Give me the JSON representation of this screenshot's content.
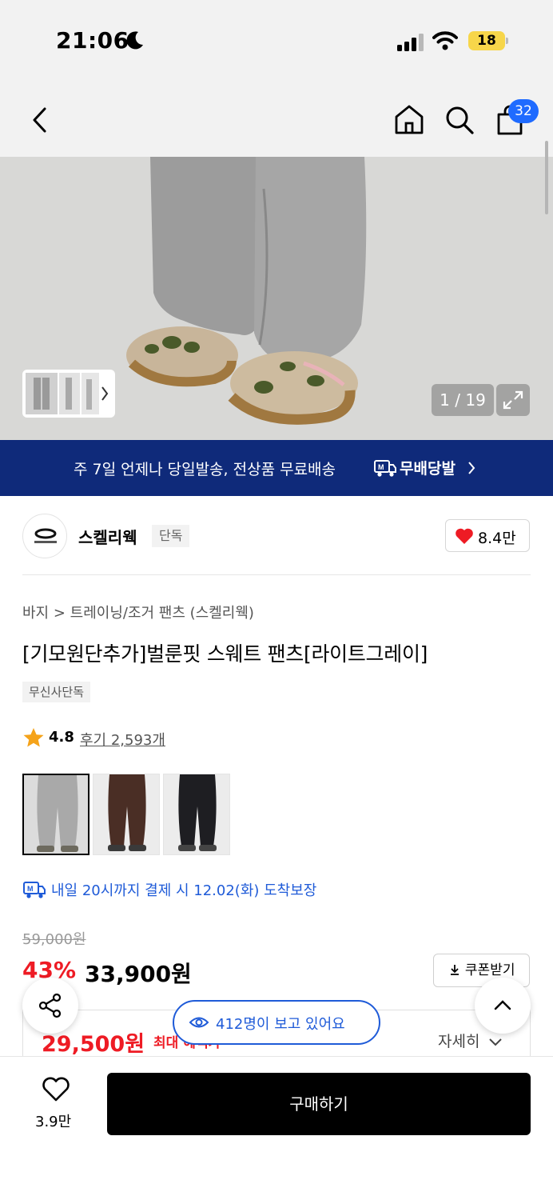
{
  "status_bar": {
    "time": "21:06",
    "battery": "18"
  },
  "nav": {
    "cart_count": "32"
  },
  "gallery": {
    "counter": "1 / 19"
  },
  "banner": {
    "text": "주 7일 언제나 당일발송, 전상품 무료배송",
    "brand": "무배당발"
  },
  "brand": {
    "name": "스켈리웩",
    "tag": "단독",
    "likes": "8.4만"
  },
  "breadcrumb": "바지 > 트레이닝/조거 팬츠 (스켈리웩)",
  "product": {
    "title": "[기모원단추가]벌룬핏 스웨트 팬츠[라이트그레이]",
    "exclusive_tag": "무신사단독",
    "rating": "4.8",
    "reviews": "후기 2,593개"
  },
  "delivery": {
    "text": "내일 20시까지 결제 시 12.02(화) 도착보장"
  },
  "price": {
    "original": "59,000원",
    "discount": "43%",
    "current": "33,900원",
    "coupon_label": "쿠폰받기",
    "max_price": "29,500원",
    "max_label": "최대 혜택가",
    "detail_label": "자세히"
  },
  "floating": {
    "viewers": "412명이 보고 있어요"
  },
  "bottom": {
    "wish_count": "3.9만",
    "buy_label": "구매하기"
  },
  "colors": {
    "accent_blue": "#1f5bd8",
    "sale_red": "#ee1b24",
    "banner_navy": "#0f2a7a"
  }
}
